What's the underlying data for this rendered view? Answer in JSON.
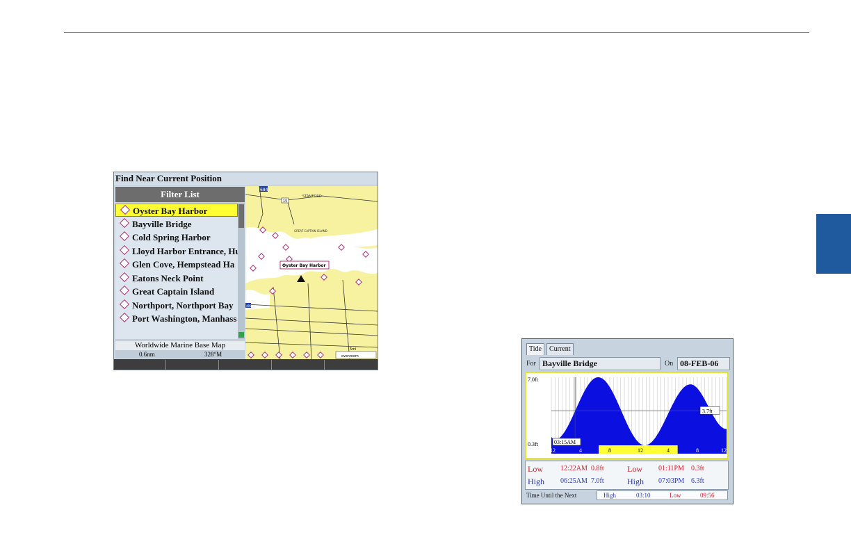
{
  "find_near": {
    "title": "Find Near Current Position",
    "filter_label": "Filter List",
    "items": [
      "Oyster Bay Harbor",
      "Bayville Bridge",
      "Cold Spring Harbor",
      "Lloyd Harbor Entrance, Hu",
      "Glen Cove, Hempstead Ha",
      "Eatons Neck Point",
      "Great Captain Island",
      "Northport, Northport Bay",
      "Port Washington, Manhass"
    ],
    "selected_index": 0,
    "base_map": "Worldwide Marine Base Map",
    "distance": "0.6nm",
    "bearing": "328°M",
    "map": {
      "callout": "Oyster Bay Harbor",
      "labels": {
        "stamford": "STAMFORD",
        "island": "GREAT CAPTAIN ISLAND",
        "route_684": "684",
        "route_15": "15",
        "route_495": "495",
        "scale": "5mi",
        "overzoom": "overzoom"
      }
    }
  },
  "tides": {
    "tabs": [
      "Tide",
      "Current"
    ],
    "active_tab": "Tide",
    "for_label": "For",
    "location": "Bayville Bridge",
    "on_label": "On",
    "date": "08-FEB-06",
    "chart_data": {
      "type": "area",
      "ylim": [
        0.3,
        7.0
      ],
      "y_top_label": "7.0ft",
      "y_bottom_label": "0.3ft",
      "x_tick_labels": [
        "12",
        "4",
        "8",
        "12",
        "4",
        "8",
        "12"
      ],
      "current_time_label": "03:15AM",
      "current_level_label": "3.7ft",
      "current_level": 3.7,
      "x_hours": [
        0,
        0.37,
        6.42,
        12.8,
        19.05,
        24
      ],
      "heights": [
        1.1,
        0.8,
        7.0,
        0.3,
        6.3,
        1.9
      ]
    },
    "table": {
      "low_label": "Low",
      "high_label": "High",
      "low1_time": "12:22AM",
      "low1_height": "0.8ft",
      "low2_time": "01:11PM",
      "low2_height": "0.3ft",
      "high1_time": "06:25AM",
      "high1_height": "7.0ft",
      "high2_time": "07:03PM",
      "high2_height": "6.3ft"
    },
    "until": {
      "label": "Time Until the Next",
      "high_label": "High",
      "high_value": "03:10",
      "low_label": "Low",
      "low_value": "09:56"
    },
    "colors": {
      "tide_fill": "#0b10e0",
      "low_text": "#d2212a",
      "high_text": "#2a3ab0",
      "day_bar": "#ffff33",
      "night_bar": "#0b10e0"
    }
  }
}
